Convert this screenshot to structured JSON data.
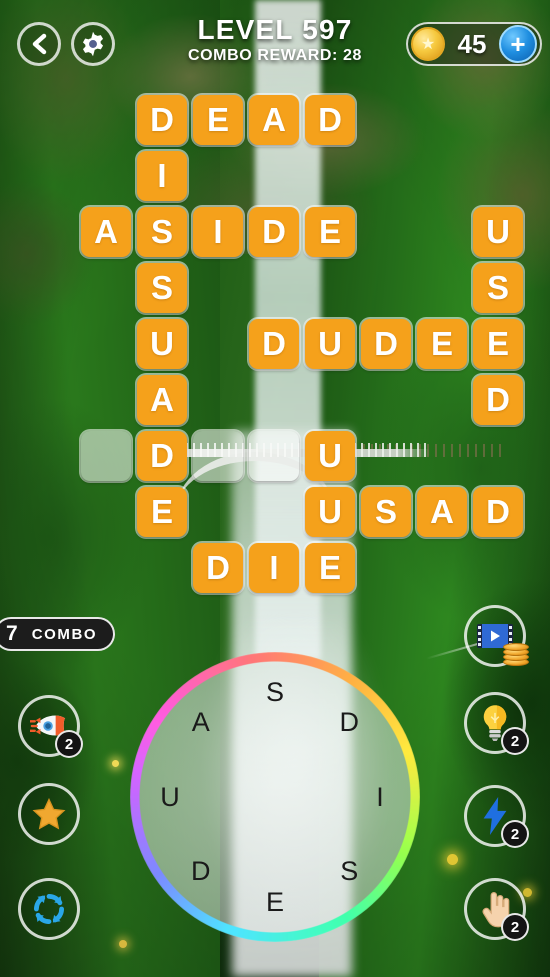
{
  "header": {
    "back_icon": "chevron-left-icon",
    "settings_icon": "gear-icon",
    "level_title": "LEVEL 597",
    "combo_reward": "COMBO REWARD: 28",
    "coin_icon": "star-coin-icon",
    "coin_count": "45",
    "coin_plus_label": "+"
  },
  "colors": {
    "tile_fill": "#f5a11b",
    "tile_text": "#ffffff",
    "empty_tile": "rgba(255,255,255,0.55)",
    "badge_bg": "#1c1c1c",
    "coin_gold": "#f6c93f",
    "plus_blue": "#1f8ee0"
  },
  "grid": {
    "columns": 8,
    "rows": [
      [
        null,
        "D",
        "E",
        "A",
        "D",
        null,
        null,
        null
      ],
      [
        null,
        "I",
        null,
        null,
        null,
        null,
        null,
        null
      ],
      [
        "A",
        "S",
        "I",
        "D",
        "E",
        null,
        null,
        "U"
      ],
      [
        null,
        "S",
        null,
        null,
        null,
        null,
        null,
        "S"
      ],
      [
        null,
        "U",
        null,
        "D",
        "U",
        "D",
        "E",
        "E"
      ],
      [
        null,
        "A",
        null,
        null,
        null,
        null,
        null,
        "D"
      ],
      [
        "",
        "D",
        "",
        "",
        "U",
        null,
        null,
        null
      ],
      [
        null,
        "E",
        null,
        null,
        "U",
        "S",
        "A",
        "D"
      ],
      [
        null,
        null,
        "D",
        "I",
        "E",
        null,
        null,
        null
      ]
    ]
  },
  "combo": {
    "count": "7",
    "label": "COMBO"
  },
  "wheel": {
    "letters": [
      "S",
      "D",
      "I",
      "S",
      "E",
      "D",
      "U",
      "A"
    ]
  },
  "powerups": {
    "left": [
      {
        "name": "rocket-powerup",
        "icon": "rocket-icon",
        "badge": "2"
      },
      {
        "name": "star-powerup",
        "icon": "star-icon",
        "badge": ""
      },
      {
        "name": "shuffle-powerup",
        "icon": "shuffle-icon",
        "badge": ""
      }
    ],
    "right": [
      {
        "name": "video-coins-button",
        "icon": "video-icon",
        "badge": ""
      },
      {
        "name": "hint-powerup",
        "icon": "lightbulb-icon",
        "badge": "2"
      },
      {
        "name": "lightning-powerup",
        "icon": "lightning-bolt-icon",
        "badge": "2"
      },
      {
        "name": "tap-powerup",
        "icon": "hand-pointer-icon",
        "badge": "2"
      }
    ]
  }
}
